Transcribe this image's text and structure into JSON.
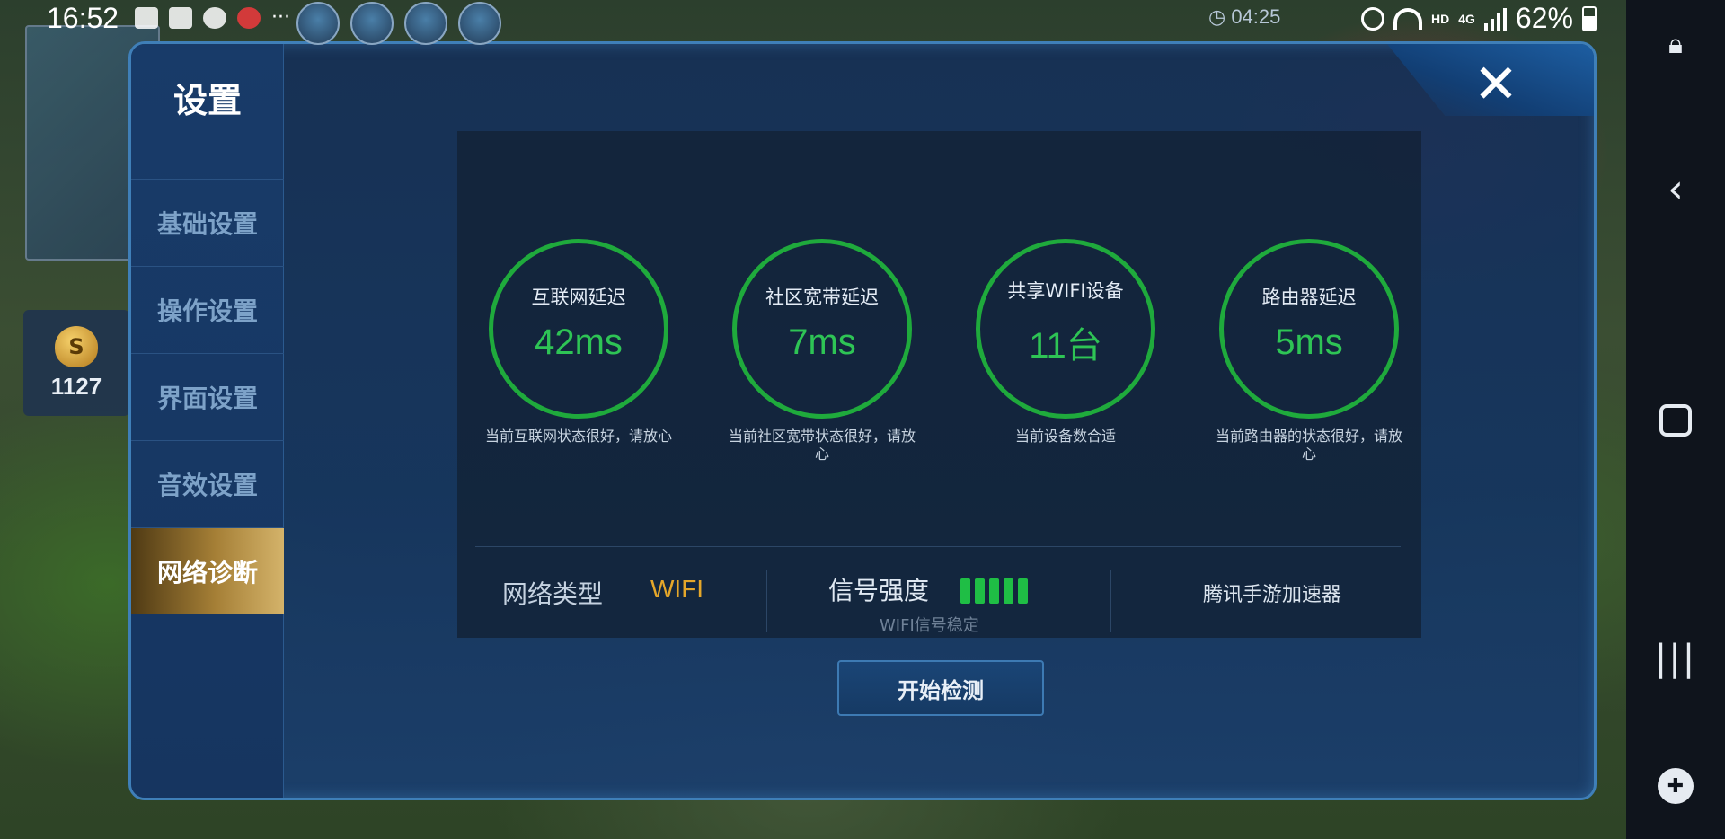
{
  "status_bar": {
    "time": "16:52",
    "game_timer": "04:25",
    "network_label": "HD",
    "signal_label": "4G",
    "battery": "62%"
  },
  "hud": {
    "gold": "1127"
  },
  "dialog": {
    "title": "设置",
    "close_label": "✕",
    "sidebar": [
      {
        "label": "基础设置",
        "active": false
      },
      {
        "label": "操作设置",
        "active": false
      },
      {
        "label": "界面设置",
        "active": false
      },
      {
        "label": "音效设置",
        "active": false
      },
      {
        "label": "网络诊断",
        "active": true
      }
    ],
    "metrics": [
      {
        "label": "互联网延迟",
        "value": "42ms",
        "description": "当前互联网状态很好，请放心"
      },
      {
        "label": "社区宽带延迟",
        "value": "7ms",
        "description": "当前社区宽带状态很好，请放心"
      },
      {
        "label": "共享WIFI设备",
        "value": "11台",
        "description": "当前设备数合适"
      },
      {
        "label": "路由器延迟",
        "value": "5ms",
        "description": "当前路由器的状态很好，请放心"
      }
    ],
    "network_type_label": "网络类型",
    "network_type_value": "WIFI",
    "signal_strength_label": "信号强度",
    "signal_strength_level": 5,
    "signal_status": "WIFI信号稳定",
    "accelerator_label": "腾讯手游加速器",
    "start_button": "开始检测",
    "accent_color": "#1faa3c",
    "active_tab_color": "#a57f36"
  },
  "icons": {
    "status": [
      "chat-icon",
      "gallery-icon",
      "sync-icon",
      "game-icon",
      "alarm-icon",
      "wifi-icon",
      "signal-icon",
      "battery-icon"
    ],
    "nav": [
      "lock-icon",
      "back-icon",
      "home-icon",
      "recent-apps-icon",
      "game-tools-icon"
    ]
  }
}
